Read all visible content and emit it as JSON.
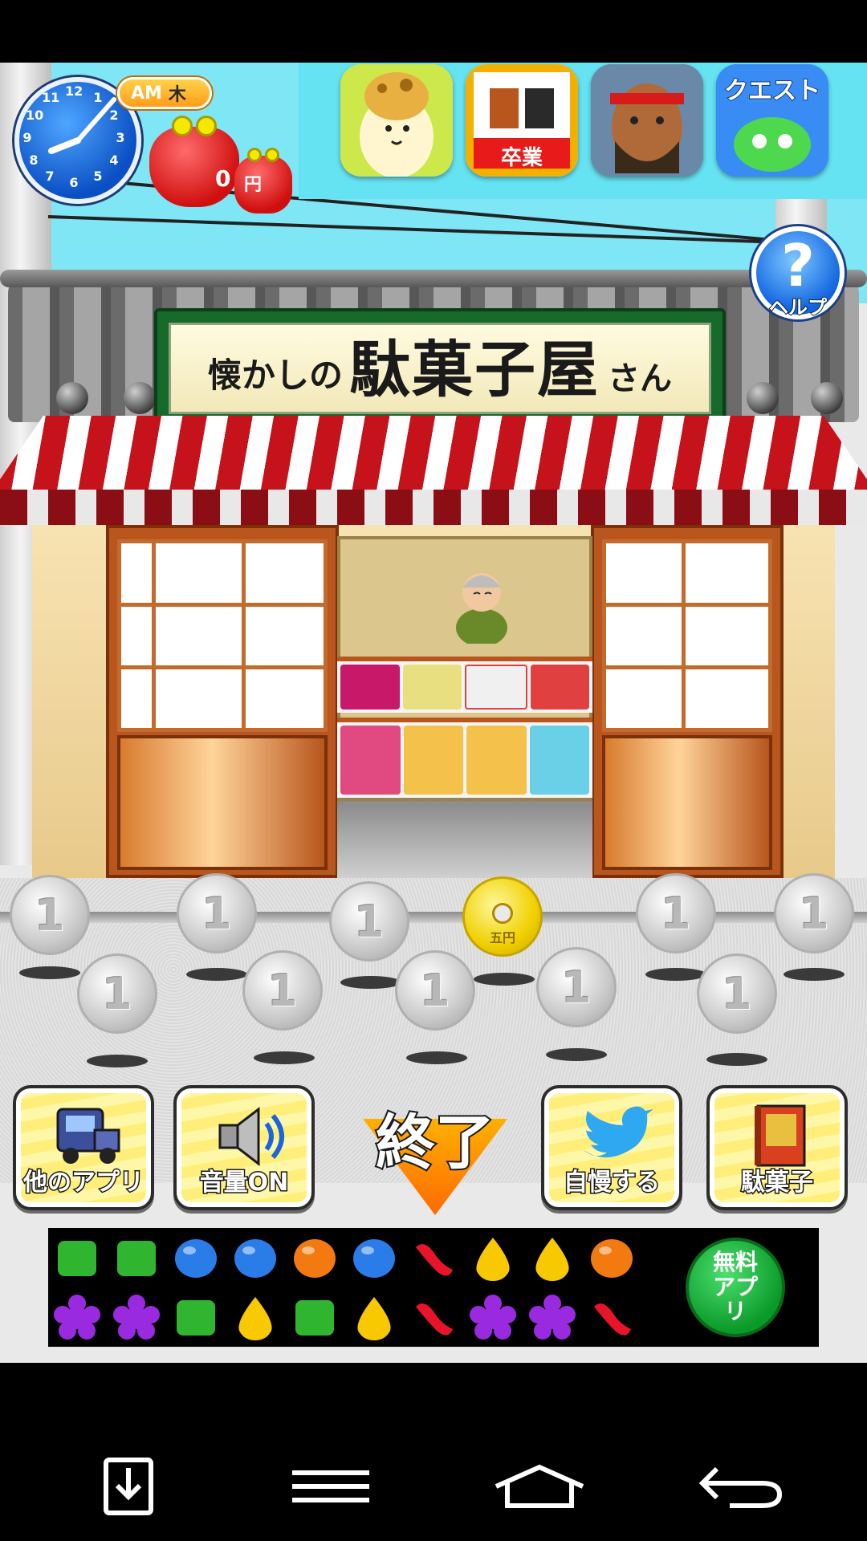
{
  "clock": {
    "numbers": [
      "12",
      "1",
      "2",
      "3",
      "4",
      "5",
      "6",
      "7",
      "8",
      "9",
      "10",
      "11"
    ],
    "period": "AM",
    "weekday": "木"
  },
  "wallet": {
    "amount": "0",
    "unit": "円"
  },
  "help": {
    "label": "ヘルプ",
    "symbol": "?"
  },
  "ads": [
    {
      "name": "giraffe-app-icon",
      "color": "#cde84a"
    },
    {
      "name": "graduation-app-icon",
      "color": "#e84a1a",
      "text": "卒業"
    },
    {
      "name": "warrior-app-icon",
      "color": "#5b7a9a"
    },
    {
      "name": "quest-app-icon",
      "color": "#2b7bf0",
      "text": "クエスト"
    }
  ],
  "shop_sign": {
    "small": "懐かしの",
    "big": "駄菓子屋",
    "tail": "さん"
  },
  "coins": {
    "silver_label": "1",
    "gold_label": "五円"
  },
  "buttons": {
    "other_apps": "他のアプリ",
    "volume": "音量ON",
    "end": "終了",
    "brag": "自慢する",
    "dagashi": "駄菓子"
  },
  "banner": {
    "free_app_label": "無料アプリ",
    "candy_rows": [
      [
        "green",
        "green",
        "blue",
        "blue",
        "orange",
        "blue",
        "red",
        "yellow",
        "yellow",
        "orange"
      ],
      [
        "purple",
        "purple",
        "green",
        "yellow",
        "green",
        "yellow",
        "red",
        "purple",
        "purple",
        "red"
      ]
    ],
    "candy_colors": {
      "green": "#2fb52f",
      "blue": "#2a7de8",
      "orange": "#f27a10",
      "red": "#e8142a",
      "yellow": "#f8c800",
      "purple": "#9a2ae0"
    }
  },
  "colors": {
    "sky": "#7fe6f5",
    "awning_red": "#c6121b",
    "sign_green": "#17692c"
  }
}
